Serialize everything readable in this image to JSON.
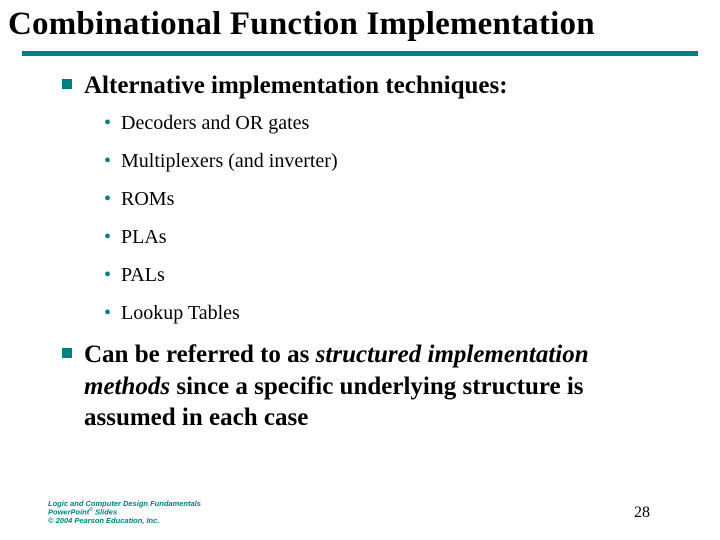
{
  "title": "Combinational Function Implementation",
  "sections": [
    {
      "text": "Alternative implementation techniques:",
      "items": [
        "Decoders and OR gates",
        "Multiplexers (and inverter)",
        "ROMs",
        "PLAs",
        "PALs",
        "Lookup Tables"
      ]
    },
    {
      "pre": "Can be referred to as ",
      "em": "structured implementation methods",
      "post": " since a specific underlying structure is assumed in each case"
    }
  ],
  "footer": {
    "line1": "Logic and Computer Design Fundamentals",
    "line2_a": "PowerPoint",
    "line2_sup": "©",
    "line2_b": " Slides",
    "line3": "© 2004 Pearson Education, Inc."
  },
  "page": "28"
}
